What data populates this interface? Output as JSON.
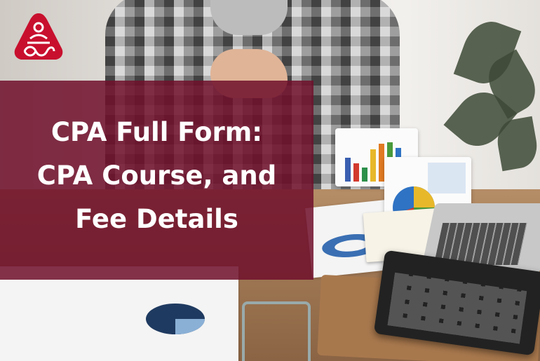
{
  "hero": {
    "title_lines": [
      "CPA Full Form:",
      "CPA Course, and",
      "Fee Details"
    ],
    "overlay_color": "#70102c",
    "text_color": "#ffffff"
  },
  "logo": {
    "icon": "brand-logo-icon",
    "color": "#c8102e"
  },
  "background": {
    "description_icons": [
      "person-in-plaid-shirt",
      "bar-chart-paper",
      "pie-chart-paper",
      "calculator",
      "laptop",
      "plant"
    ]
  }
}
